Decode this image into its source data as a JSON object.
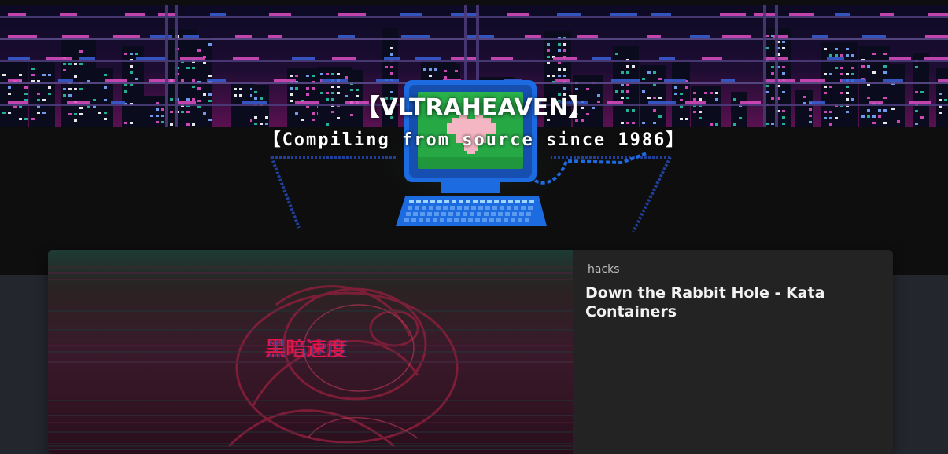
{
  "site": {
    "title": "【VLTRAHEAVEN】",
    "tagline": "【Compiling from source since 1986】"
  },
  "post": {
    "tag": "hacks",
    "title": "Down the Rabbit Hole - Kata Containers",
    "image_text": "黑暗速度"
  },
  "colors": {
    "hero_bg": "#0e0e0f",
    "page_bg": "#23262d",
    "card_bg": "#232323",
    "neon_pink": "#e14fc4",
    "neon_teal": "#27c2a4",
    "monitor_blue": "#1c6be0",
    "screen_green": "#26a845",
    "heart_pink": "#f4b6c2",
    "image_text": "#e8174a"
  },
  "icons": {
    "hero_art": "retro-computer-city-icon",
    "heart": "heart-icon"
  }
}
